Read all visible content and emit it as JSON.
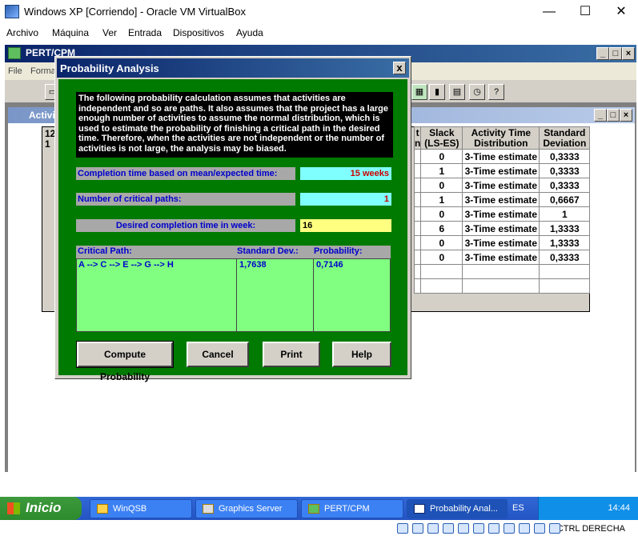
{
  "host": {
    "title": "Windows XP [Corriendo] - Oracle VM VirtualBox",
    "menu": [
      "Archivo",
      "Máquina",
      "Ver",
      "Entrada",
      "Dispositivos",
      "Ayuda"
    ],
    "minimize": "—",
    "maximize": "☐",
    "close": "✕",
    "host_key": "CTRL DERECHA"
  },
  "app": {
    "title": "PERT/CPM",
    "menu": [
      "File",
      "Forma"
    ],
    "activity_window_title": "Activi",
    "grid_left_header": "12\n1",
    "grid": {
      "headers": [
        "t\nn",
        "Slack\n(LS-ES)",
        "Activity Time\nDistribution",
        "Standard\nDeviation"
      ],
      "rows": [
        {
          "slack": "0",
          "dist": "3-Time estimate",
          "sd": "0,3333"
        },
        {
          "slack": "1",
          "dist": "3-Time estimate",
          "sd": "0,3333"
        },
        {
          "slack": "0",
          "dist": "3-Time estimate",
          "sd": "0,3333"
        },
        {
          "slack": "1",
          "dist": "3-Time estimate",
          "sd": "0,6667"
        },
        {
          "slack": "0",
          "dist": "3-Time estimate",
          "sd": "1"
        },
        {
          "slack": "6",
          "dist": "3-Time estimate",
          "sd": "1,3333"
        },
        {
          "slack": "0",
          "dist": "3-Time estimate",
          "sd": "1,3333"
        },
        {
          "slack": "0",
          "dist": "3-Time estimate",
          "sd": "0,3333"
        }
      ]
    }
  },
  "dialog": {
    "title": "Probability Analysis",
    "close": "x",
    "intro": "The following probability calculation assumes that activities are independent and so are paths. It also assumes that the project has a large enough number of activities to assume the normal distribution, which is used to estimate the probability of finishing a critical path in the desired time.  Therefore, when the activities are not independent or the number of activities is not large, the analysis may be biased.",
    "completion_label": "Completion time based on mean/expected time:",
    "completion_value": "15 weeks",
    "critical_paths_label": "Number of critical paths:",
    "critical_paths_value": "1",
    "desired_label": "Desired completion time in week:",
    "desired_value": "16",
    "cp_headers": {
      "path": "Critical Path:",
      "sd": "Standard Dev.:",
      "prob": "Probability:"
    },
    "cp_row": {
      "path": "A --> C --> E --> G --> H",
      "sd": "1,7638",
      "prob": "0,7146"
    },
    "buttons": {
      "compute": "Compute Probability",
      "cancel": "Cancel",
      "print": "Print",
      "help": "Help"
    }
  },
  "taskbar": {
    "start": "Inicio",
    "tasks": [
      "WinQSB",
      "Graphics Server",
      "PERT/CPM",
      "Probability Anal..."
    ],
    "lang": "ES",
    "clock": "14:44"
  }
}
